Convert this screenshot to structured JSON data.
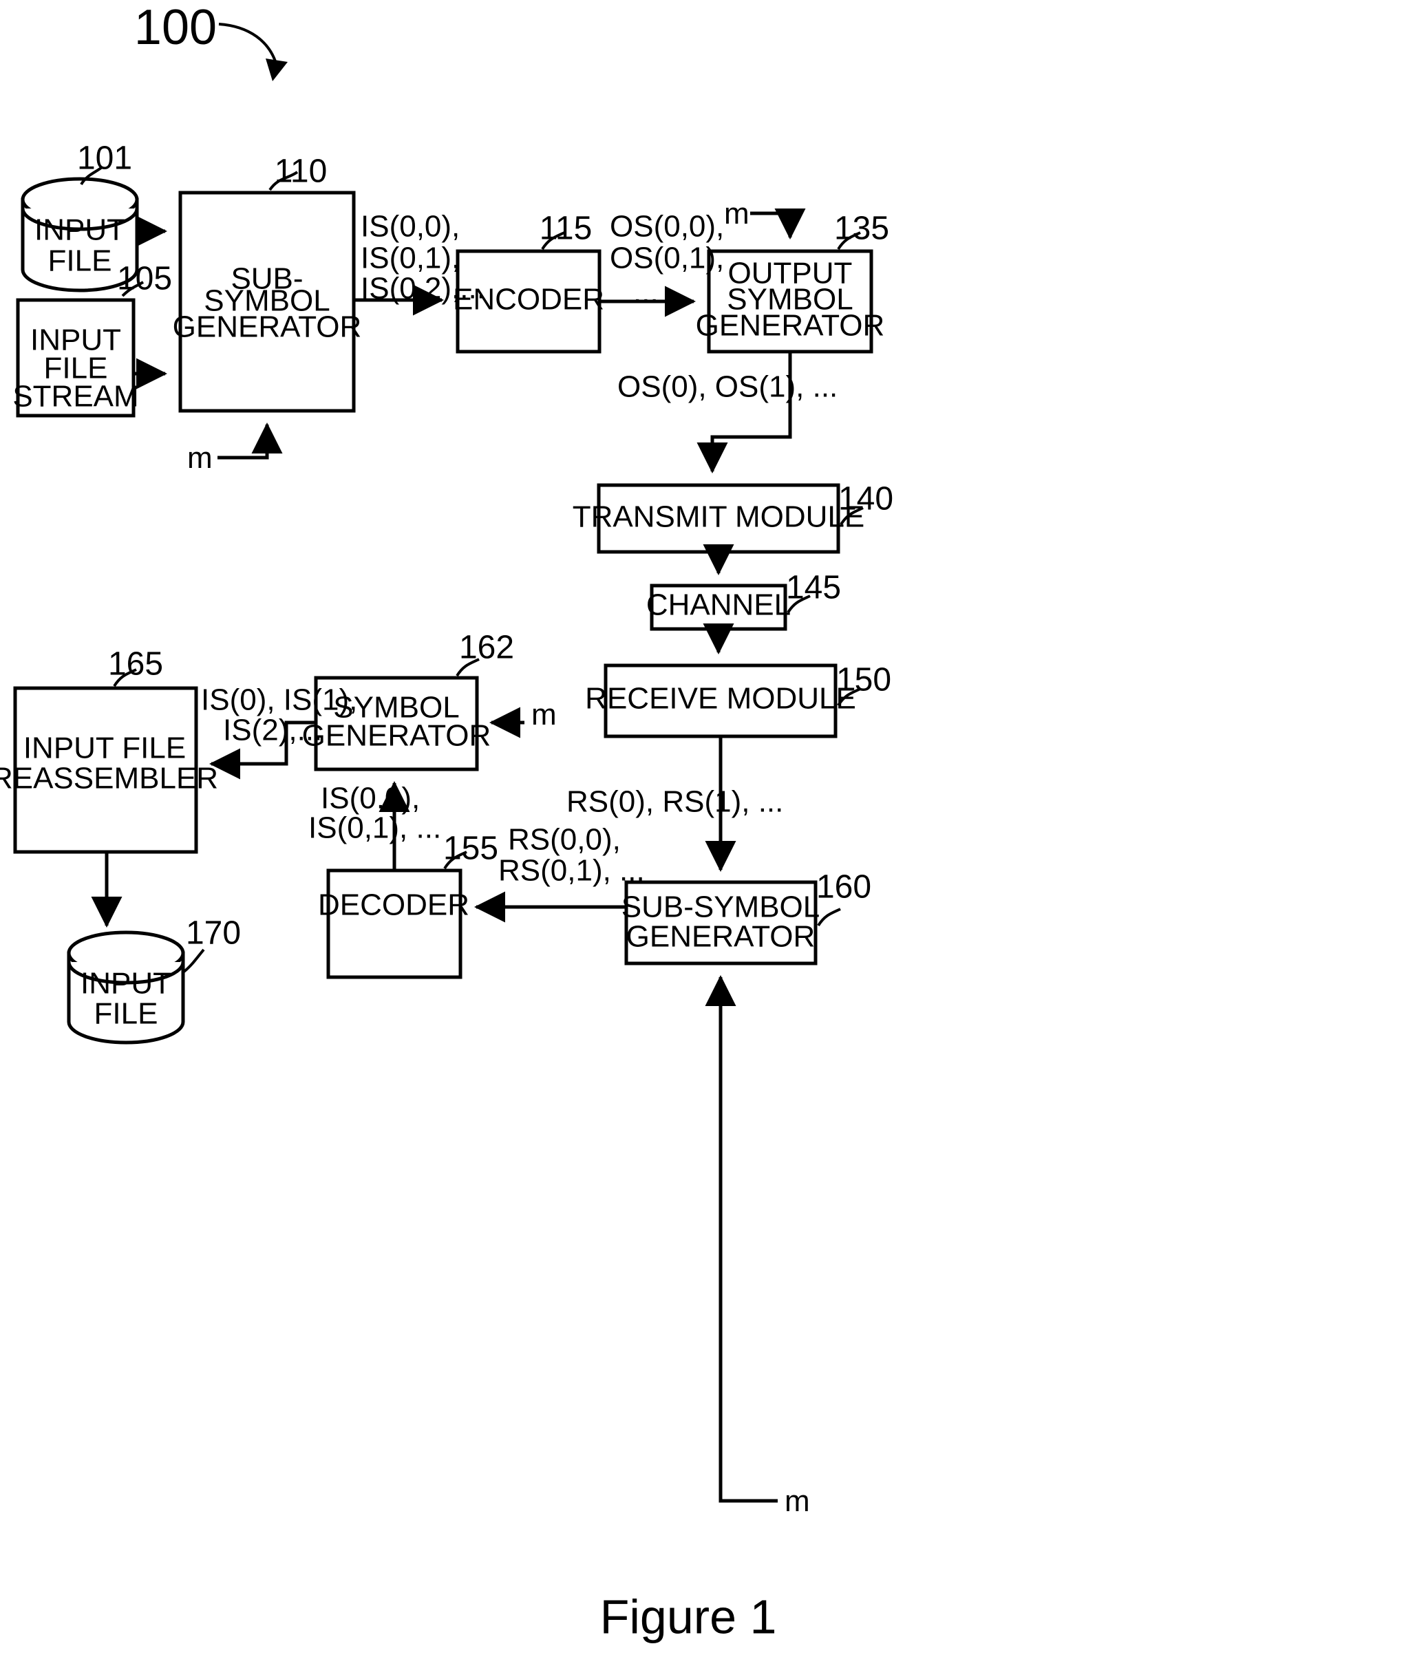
{
  "figure": {
    "caption": "Figure 1",
    "system_ref": "100"
  },
  "nodes": [
    {
      "id": "input_file_src",
      "shape": "cylinder",
      "label": [
        "INPUT",
        "FILE"
      ],
      "ref": "101"
    },
    {
      "id": "input_file_stream",
      "shape": "rect",
      "label": [
        "INPUT",
        "FILE",
        "STREAM"
      ],
      "ref": "105"
    },
    {
      "id": "sub_symbol_generator",
      "shape": "rect",
      "label": [
        "SUB-",
        "SYMBOL",
        "GENERATOR"
      ],
      "ref": "110"
    },
    {
      "id": "encoder",
      "shape": "rect",
      "label": [
        "ENCODER"
      ],
      "ref": "115"
    },
    {
      "id": "output_symbol_generator",
      "shape": "rect",
      "label": [
        "OUTPUT",
        "SYMBOL",
        "GENERATOR"
      ],
      "ref": "135"
    },
    {
      "id": "transmit_module",
      "shape": "rect",
      "label": [
        "TRANSMIT MODULE"
      ],
      "ref": "140"
    },
    {
      "id": "channel",
      "shape": "rect",
      "label": [
        "CHANNEL"
      ],
      "ref": "145"
    },
    {
      "id": "receive_module",
      "shape": "rect",
      "label": [
        "RECEIVE MODULE"
      ],
      "ref": "150"
    },
    {
      "id": "sub_symbol_generator_rx",
      "shape": "rect",
      "label": [
        "SUB-SYMBOL",
        "GENERATOR"
      ],
      "ref": "160"
    },
    {
      "id": "decoder",
      "shape": "rect",
      "label": [
        "DECODER"
      ],
      "ref": "155"
    },
    {
      "id": "symbol_generator",
      "shape": "rect",
      "label": [
        "SYMBOL",
        "GENERATOR"
      ],
      "ref": "162"
    },
    {
      "id": "input_file_reassembler",
      "shape": "rect",
      "label": [
        "INPUT FILE",
        "REASSEMBLER"
      ],
      "ref": "165"
    },
    {
      "id": "input_file_out",
      "shape": "cylinder",
      "label": [
        "INPUT",
        "FILE"
      ],
      "ref": "170"
    }
  ],
  "edge_labels": {
    "is_sub_symbols": [
      "IS(0,0),",
      "IS(0,1),",
      "IS(0,2),..."
    ],
    "os_sub_symbols": [
      "OS(0,0),",
      "OS(0,1),",
      "..."
    ],
    "os_symbols": [
      "OS(0), OS(1), ..."
    ],
    "rs_symbols": [
      "RS(0), RS(1), ..."
    ],
    "rs_sub_symbols": [
      "RS(0,0),",
      "RS(0,1), ..."
    ],
    "is_sub_symbols_rx": [
      "IS(0,0),",
      "IS(0,1), ..."
    ],
    "is_symbols": [
      "IS(0), IS(1),",
      "IS(2),..."
    ]
  },
  "parameter_inputs": [
    {
      "id": "m_sub_symbol_generator",
      "label": "m"
    },
    {
      "id": "m_output_symbol_generator",
      "label": "m"
    },
    {
      "id": "m_symbol_generator",
      "label": "m"
    },
    {
      "id": "m_sub_symbol_generator_rx",
      "label": "m"
    }
  ]
}
